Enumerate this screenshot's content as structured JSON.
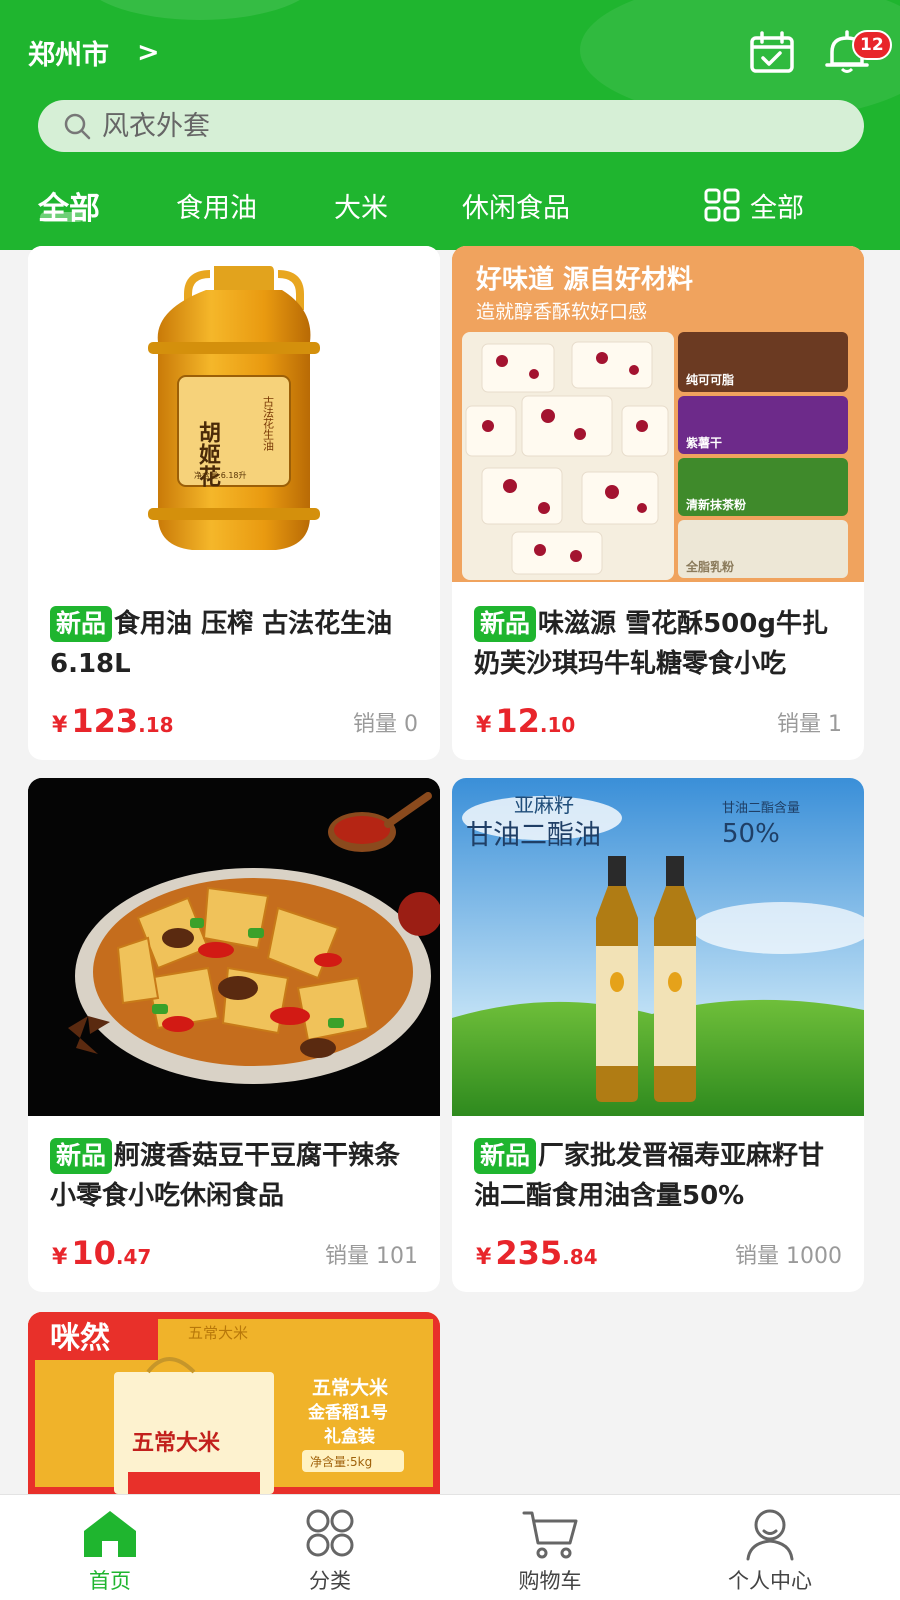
{
  "header": {
    "city": "郑州市",
    "city_chevron": ">",
    "notification_count": "12",
    "search_placeholder": "风衣外套"
  },
  "tabs": [
    {
      "label": "全部",
      "active": true
    },
    {
      "label": "食用油"
    },
    {
      "label": "大米"
    },
    {
      "label": "休闲食品"
    },
    {
      "label": "全部",
      "icon": "grid-icon"
    }
  ],
  "products": [
    {
      "tag": "新品",
      "title": "食用油 压榨 古法花生油6.18L",
      "price_currency": "¥",
      "price_int": "123",
      "price_dec": ".18",
      "sales": "销量 0",
      "image": {
        "bottle_label": "胡姬花",
        "bottle_side": "古法花生油",
        "bottle_volume": "净含量:6.18升"
      }
    },
    {
      "tag": "新品",
      "title": "味滋源 雪花酥500g牛扎奶芙沙琪玛牛轧糖零食小吃",
      "price_currency": "¥",
      "price_int": "12",
      "price_dec": ".10",
      "sales": "销量 1",
      "image": {
        "headline": "好味道 源自好材料",
        "subline": "造就醇香酥软好口感",
        "ingredients": [
          "纯可可脂",
          "紫薯干",
          "清新抹茶粉",
          "全脂乳粉"
        ]
      }
    },
    {
      "tag": "新品",
      "title": "舸渡香菇豆干豆腐干辣条小零食小吃休闲食品",
      "price_currency": "¥",
      "price_int": "10",
      "price_dec": ".47",
      "sales": "销量 101"
    },
    {
      "tag": "新品",
      "title": "厂家批发晋福寿亚麻籽甘油二酯食用油含量50%",
      "price_currency": "¥",
      "price_int": "235",
      "price_dec": ".84",
      "sales": "销量 1000",
      "image": {
        "small_title": "亚麻籽",
        "big_title": "甘油二酯油",
        "content_label": "甘油二酯含量",
        "content_value": "50%"
      }
    },
    {
      "image": {
        "brand": "咪然",
        "banner_top": "五常大米",
        "lines": [
          "五常大米",
          "金香稻1号",
          "礼盒装"
        ],
        "net": "净含量:5kg",
        "box_title": "五常大米"
      }
    }
  ],
  "bottom_nav": [
    {
      "label": "首页",
      "icon": "home-icon",
      "active": true
    },
    {
      "label": "分类",
      "icon": "category-icon"
    },
    {
      "label": "购物车",
      "icon": "cart-icon"
    },
    {
      "label": "个人中心",
      "icon": "user-icon"
    }
  ],
  "colors": {
    "brand_green": "#1fb52f",
    "price_red": "#e8252b",
    "badge_red": "#e8252b"
  }
}
